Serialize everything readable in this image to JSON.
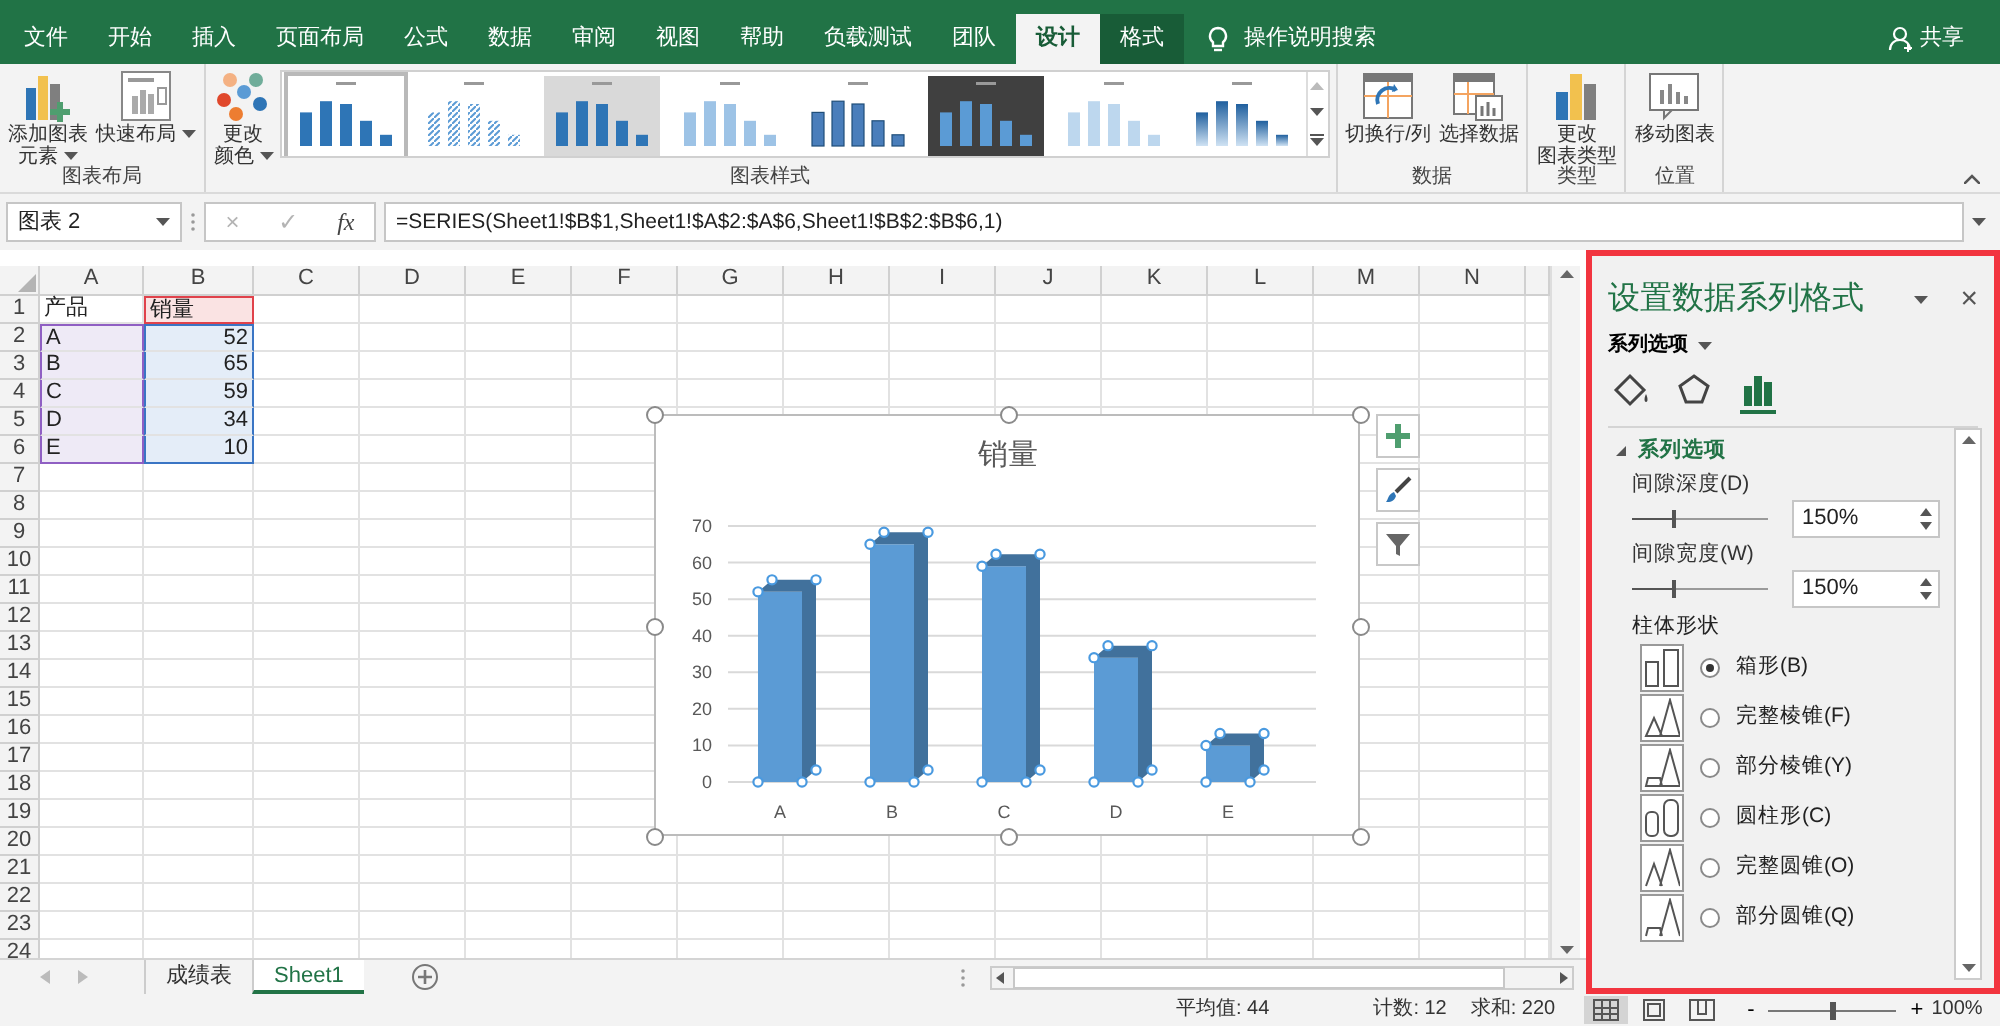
{
  "ribbon_tabs": [
    {
      "label": "文件",
      "selected": false,
      "contextual": false
    },
    {
      "label": "开始",
      "selected": false,
      "contextual": false
    },
    {
      "label": "插入",
      "selected": false,
      "contextual": false
    },
    {
      "label": "页面布局",
      "selected": false,
      "contextual": false
    },
    {
      "label": "公式",
      "selected": false,
      "contextual": false
    },
    {
      "label": "数据",
      "selected": false,
      "contextual": false
    },
    {
      "label": "审阅",
      "selected": false,
      "contextual": false
    },
    {
      "label": "视图",
      "selected": false,
      "contextual": false
    },
    {
      "label": "帮助",
      "selected": false,
      "contextual": false
    },
    {
      "label": "负载测试",
      "selected": false,
      "contextual": false
    },
    {
      "label": "团队",
      "selected": false,
      "contextual": false
    },
    {
      "label": "设计",
      "selected": true,
      "contextual": true
    },
    {
      "label": "格式",
      "selected": false,
      "contextual": true
    }
  ],
  "tell_me": "操作说明搜索",
  "share": "共享",
  "ribbon_groups": [
    {
      "label": "图表布局",
      "buttons": [
        {
          "lines": [
            "添加图表",
            "元素"
          ],
          "kind": "add-element",
          "dropdown": true
        },
        {
          "lines": [
            "快速布局"
          ],
          "kind": "quick-layout",
          "dropdown": true
        }
      ]
    },
    {
      "label": "图表样式",
      "buttons": [
        {
          "lines": [
            "更改",
            "颜色"
          ],
          "kind": "colors",
          "dropdown": true
        }
      ],
      "gallery": [
        {
          "kind": "plain",
          "selected": true
        },
        {
          "kind": "hatched",
          "selected": false
        },
        {
          "kind": "shaded",
          "selected": false
        },
        {
          "kind": "pale",
          "selected": false
        },
        {
          "kind": "outlined",
          "selected": false
        },
        {
          "kind": "dark",
          "selected": false
        },
        {
          "kind": "light",
          "selected": false
        },
        {
          "kind": "gradient",
          "selected": false
        }
      ]
    },
    {
      "label": "数据",
      "buttons": [
        {
          "lines": [
            "切换行/列"
          ],
          "kind": "switch",
          "dropdown": false
        },
        {
          "lines": [
            "选择数据"
          ],
          "kind": "select-data",
          "dropdown": false
        }
      ]
    },
    {
      "label": "类型",
      "buttons": [
        {
          "lines": [
            "更改",
            "图表类型"
          ],
          "kind": "change-type",
          "dropdown": false
        }
      ]
    },
    {
      "label": "位置",
      "buttons": [
        {
          "lines": [
            "移动图表"
          ],
          "kind": "move-chart",
          "dropdown": false
        }
      ]
    }
  ],
  "name_box": "图表 2",
  "formula_buttons": [
    {
      "label": "×",
      "disabled": true
    },
    {
      "label": "✓",
      "disabled": true
    },
    {
      "label": "fx",
      "disabled": false
    }
  ],
  "formula": "=SERIES(Sheet1!$B$1,Sheet1!$A$2:$A$6,Sheet1!$B$2:$B$6,1)",
  "columns": [
    "A",
    "B",
    "C",
    "D",
    "E",
    "F",
    "G",
    "H",
    "I",
    "J",
    "K",
    "L",
    "M",
    "N"
  ],
  "rows": [
    "1",
    "2",
    "3",
    "4",
    "5",
    "6",
    "7",
    "8",
    "9",
    "10",
    "11",
    "12",
    "13",
    "14",
    "15",
    "16",
    "17",
    "18",
    "19",
    "20",
    "21",
    "22",
    "23",
    "24"
  ],
  "cell_rows": [
    [
      {
        "text": "产品",
        "kind": "header"
      },
      {
        "text": "销量",
        "kind": "series-name"
      }
    ],
    [
      {
        "text": "A",
        "kind": "category"
      },
      {
        "text": "52",
        "kind": "value"
      }
    ],
    [
      {
        "text": "B",
        "kind": "category"
      },
      {
        "text": "65",
        "kind": "value"
      }
    ],
    [
      {
        "text": "C",
        "kind": "category"
      },
      {
        "text": "59",
        "kind": "value"
      }
    ],
    [
      {
        "text": "D",
        "kind": "category"
      },
      {
        "text": "34",
        "kind": "value"
      }
    ],
    [
      {
        "text": "E",
        "kind": "category"
      },
      {
        "text": "10",
        "kind": "value"
      }
    ]
  ],
  "chart": {
    "selected": true,
    "chart_data": {
      "type": "bar",
      "title": "销量",
      "categories": [
        "A",
        "B",
        "C",
        "D",
        "E"
      ],
      "series": [
        {
          "color": "#5b9bd5",
          "values": [
            52,
            65,
            59,
            34,
            10
          ]
        }
      ],
      "grid": true,
      "ylim": [
        0,
        70
      ],
      "yticks": [
        0,
        10,
        20,
        30,
        40,
        50,
        60,
        70
      ]
    }
  },
  "chart_buttons": [
    {
      "kind": "elements"
    },
    {
      "kind": "styles"
    },
    {
      "kind": "filters"
    }
  ],
  "panel": {
    "title": "设置数据系列格式",
    "close": "×",
    "options_menu": "系列选项",
    "tabs": [
      {
        "kind": "fill",
        "selected": false
      },
      {
        "kind": "effects",
        "selected": false
      },
      {
        "kind": "series",
        "selected": true
      }
    ],
    "section": {
      "label": "系列选项",
      "expanded": true
    },
    "fields": [
      {
        "label": "间隙深度(D)",
        "level": 0.3,
        "value": "150%"
      },
      {
        "label": "间隙宽度(W)",
        "level": 0.3,
        "value": "150%"
      }
    ],
    "shape_label": "柱体形状",
    "shapes": [
      {
        "label": "箱形(B)",
        "kind": "box",
        "selected": true
      },
      {
        "label": "完整棱锥(F)",
        "kind": "pyramid",
        "selected": false
      },
      {
        "label": "部分棱锥(Y)",
        "kind": "partial-pyramid",
        "selected": false
      },
      {
        "label": "圆柱形(C)",
        "kind": "cylinder",
        "selected": false
      },
      {
        "label": "完整圆锥(O)",
        "kind": "cone",
        "selected": false
      },
      {
        "label": "部分圆锥(Q)",
        "kind": "partial-cone",
        "selected": false
      }
    ]
  },
  "sheet_tabs": [
    {
      "label": "成绩表",
      "selected": false
    },
    {
      "label": "Sheet1",
      "selected": true
    }
  ],
  "status": {
    "average": "平均值: 44",
    "count": "计数: 12",
    "sum": "求和: 220",
    "views": [
      {
        "kind": "normal",
        "selected": true
      },
      {
        "kind": "page-layout",
        "selected": false
      },
      {
        "kind": "page-break",
        "selected": false
      }
    ],
    "zoom_out": "-",
    "zoom_in": "+",
    "zoom": {
      "level": 0.5,
      "value": "100%"
    }
  }
}
